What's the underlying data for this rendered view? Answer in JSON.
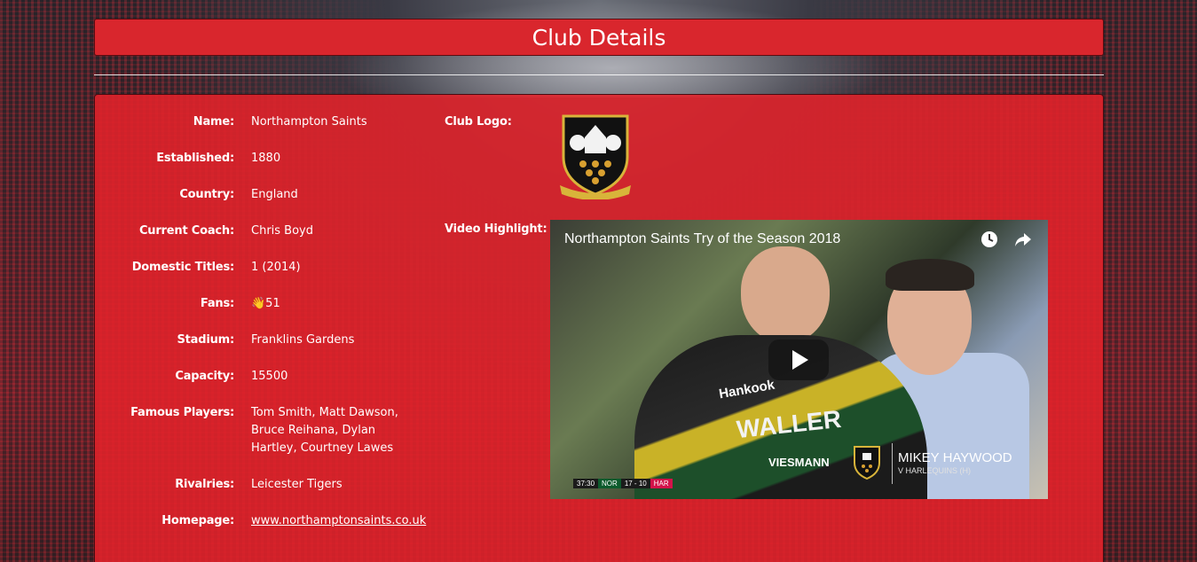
{
  "page": {
    "title": "Club Details"
  },
  "details": [
    {
      "label": "Name:",
      "value": "Northampton Saints"
    },
    {
      "label": "Established:",
      "value": "1880"
    },
    {
      "label": "Country:",
      "value": "England"
    },
    {
      "label": "Current Coach:",
      "value": "Chris Boyd"
    },
    {
      "label": "Domestic Titles:",
      "value": "1 (2014)"
    },
    {
      "label": "Fans:",
      "value": "👋51"
    },
    {
      "label": "Stadium:",
      "value": "Franklins Gardens"
    },
    {
      "label": "Capacity:",
      "value": "15500"
    },
    {
      "label": "Famous Players:",
      "value": "Tom Smith, Matt Dawson, Bruce Reihana, Dylan Hartley, Courtney Lawes"
    },
    {
      "label": "Rivalries:",
      "value": "Leicester Tigers"
    },
    {
      "label": "Homepage:",
      "value": "www.northamptonsaints.co.uk"
    }
  ],
  "media": {
    "logo_label": "Club Logo:",
    "logo_icon": "northampton-saints-crest-icon",
    "video_label": "Video Highlight:",
    "video": {
      "title": "Northampton Saints Try of the Season 2018",
      "shirt_text": "WALLER",
      "shirt_sponsor": "Hankook",
      "sponsor_bottom": "VIESMANN",
      "caption_name": "MIKEY HAYWOOD",
      "caption_sub": "V HARLEQUINS (H)",
      "score": {
        "clock": "37:30",
        "home": "NOR",
        "score": "17 - 10",
        "away": "HAR"
      }
    }
  },
  "colors": {
    "panel": "#e4222a",
    "header": "#d9262d"
  }
}
